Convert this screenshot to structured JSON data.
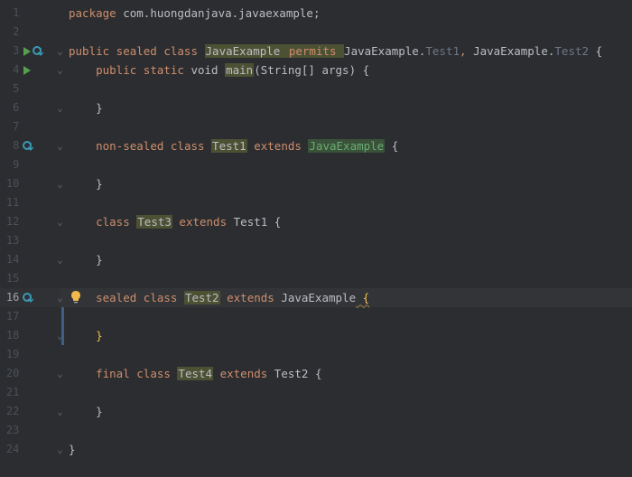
{
  "linecount": 24,
  "current_line": 16,
  "gutter_icons": {
    "3": [
      "run",
      "override"
    ],
    "4": [
      "run-blank"
    ],
    "8": [
      "override"
    ],
    "16": [
      "override",
      "bulb"
    ]
  },
  "fold_marks": [
    3,
    4,
    6,
    8,
    10,
    12,
    14,
    16,
    18,
    20,
    22,
    24
  ],
  "caret_change_start": 16,
  "code": {
    "1": {
      "indent": 0,
      "tokens": [
        [
          "kw",
          "package "
        ],
        [
          "pkg",
          "com.huongdanjava.javaexample"
        ],
        [
          "punct",
          ";"
        ]
      ]
    },
    "2": {
      "indent": 0,
      "tokens": []
    },
    "3": {
      "indent": 0,
      "tokens": [
        [
          "kw",
          "public sealed class "
        ],
        [
          "cls-hl",
          "JavaExample"
        ],
        [
          "",
          ""
        ],
        [
          "kw-permits",
          " permits "
        ],
        [
          "cls",
          "JavaExample"
        ],
        [
          "punct",
          "."
        ],
        [
          "typename-dim",
          "Test1"
        ],
        [
          "comma",
          ", "
        ],
        [
          "cls",
          "JavaExample"
        ],
        [
          "punct",
          "."
        ],
        [
          "typename-dim",
          "Test2"
        ],
        [
          "",
          ""
        ],
        [
          "brace",
          " {"
        ]
      ]
    },
    "4": {
      "indent": 1,
      "tokens": [
        [
          "kw",
          "public static "
        ],
        [
          "type",
          "void "
        ],
        [
          "mth-hl",
          "main"
        ],
        [
          "punct",
          "("
        ],
        [
          "args",
          "String[] args"
        ],
        [
          "punct",
          ")"
        ],
        [
          "brace",
          " {"
        ]
      ]
    },
    "5": {
      "indent": 1,
      "tokens": []
    },
    "6": {
      "indent": 1,
      "tokens": [
        [
          "brace",
          "}"
        ]
      ]
    },
    "7": {
      "indent": 1,
      "tokens": []
    },
    "8": {
      "indent": 1,
      "tokens": [
        [
          "kw",
          "non-sealed class "
        ],
        [
          "cls-hl",
          "Test1"
        ],
        [
          "kw",
          " extends "
        ],
        [
          "typename-green",
          "JavaExample"
        ],
        [
          "brace",
          " {"
        ]
      ]
    },
    "9": {
      "indent": 1,
      "tokens": []
    },
    "10": {
      "indent": 1,
      "tokens": [
        [
          "brace",
          "}"
        ]
      ]
    },
    "11": {
      "indent": 1,
      "tokens": []
    },
    "12": {
      "indent": 1,
      "tokens": [
        [
          "kw",
          "class "
        ],
        [
          "cls-hl",
          "Test3"
        ],
        [
          "kw",
          " extends "
        ],
        [
          "cls",
          "Test1"
        ],
        [
          "brace",
          " {"
        ]
      ]
    },
    "13": {
      "indent": 1,
      "tokens": []
    },
    "14": {
      "indent": 1,
      "tokens": [
        [
          "brace",
          "}"
        ]
      ]
    },
    "15": {
      "indent": 1,
      "tokens": []
    },
    "16": {
      "indent": 1,
      "tokens": [
        [
          "kw",
          "sealed class "
        ],
        [
          "cls-hl",
          "Test2"
        ],
        [
          "kw",
          " extends "
        ],
        [
          "cls",
          "JavaExample"
        ],
        [
          "",
          ""
        ],
        [
          "brace-warn wavy",
          " {"
        ]
      ]
    },
    "17": {
      "indent": 1,
      "tokens": []
    },
    "18": {
      "indent": 1,
      "tokens": [
        [
          "brace-warn",
          "}"
        ]
      ]
    },
    "19": {
      "indent": 1,
      "tokens": []
    },
    "20": {
      "indent": 1,
      "tokens": [
        [
          "kw",
          "final class "
        ],
        [
          "cls-hl",
          "Test4"
        ],
        [
          "kw",
          " extends "
        ],
        [
          "cls",
          "Test2"
        ],
        [
          "brace",
          " {"
        ]
      ]
    },
    "21": {
      "indent": 1,
      "tokens": []
    },
    "22": {
      "indent": 1,
      "tokens": [
        [
          "brace",
          "}"
        ]
      ]
    },
    "23": {
      "indent": 0,
      "tokens": []
    },
    "24": {
      "indent": 0,
      "tokens": [
        [
          "brace",
          "}"
        ]
      ]
    }
  }
}
